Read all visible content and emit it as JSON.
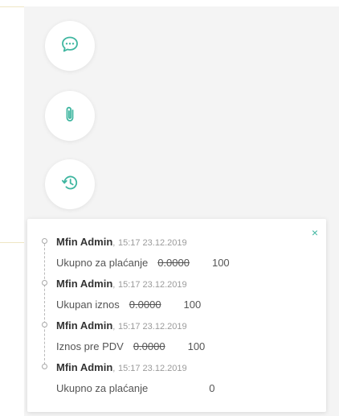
{
  "side_icons": [
    {
      "name": "comment",
      "icon": "chat-bubble-icon"
    },
    {
      "name": "attachment",
      "icon": "paperclip-icon"
    },
    {
      "name": "history",
      "icon": "history-icon"
    }
  ],
  "colors": {
    "accent": "#3fb6a0",
    "background": "#f4f4f4",
    "panel": "#ffffff",
    "text": "#333333",
    "muted": "#9b9b9b"
  },
  "history_panel": {
    "close_label": "×",
    "entries": [
      {
        "user": "Mfin Admin",
        "separator": ",",
        "time": "15:17 23.12.2019",
        "field": "Ukupno za plaćanje",
        "old_value": "0.0000",
        "new_value": "100"
      },
      {
        "user": "Mfin Admin",
        "separator": ",",
        "time": "15:17 23.12.2019",
        "field": "Ukupan iznos",
        "old_value": "0.0000",
        "new_value": "100"
      },
      {
        "user": "Mfin Admin",
        "separator": ",",
        "time": "15:17 23.12.2019",
        "field": "Iznos pre PDV",
        "old_value": "0.0000",
        "new_value": "100"
      },
      {
        "user": "Mfin Admin",
        "separator": ",",
        "time": "15:17 23.12.2019",
        "field": "Ukupno za plaćanje",
        "old_value": "",
        "new_value": "0"
      }
    ]
  }
}
